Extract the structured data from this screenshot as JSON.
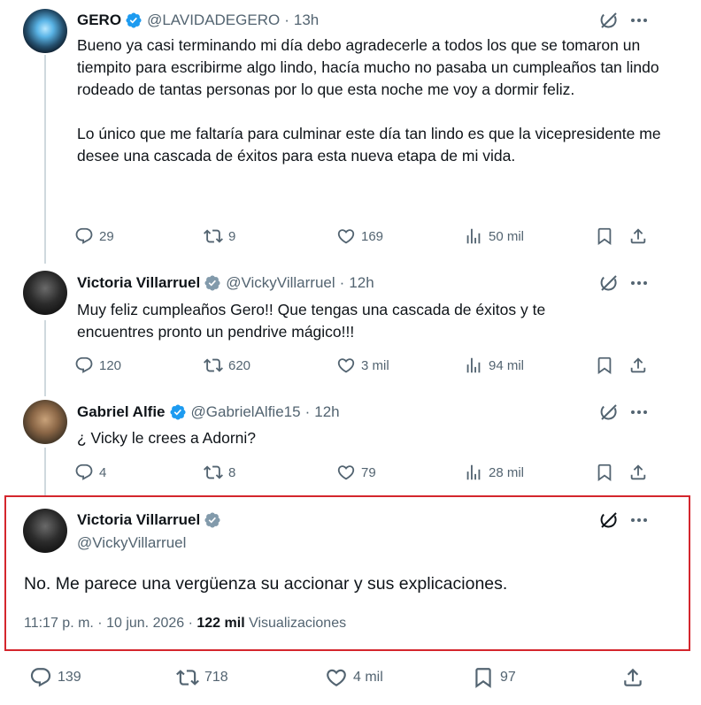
{
  "tweets": [
    {
      "name": "GERO",
      "handle": "@LAVIDADEGERO",
      "time": "13h",
      "text": "Bueno ya casi terminando mi día debo agradecerle a todos los que se tomaron un tiempito para escribirme algo lindo, hacía mucho no pasaba un cumpleaños tan lindo rodeado de tantas personas por lo que esta noche me voy a dormir feliz.\n\nLo único que me faltaría para culminar este día tan lindo es que la vicepresidente me desee una cascada de éxitos para esta nueva etapa de mi vida.",
      "replies": "29",
      "reposts": "9",
      "likes": "169",
      "views": "50 mil",
      "verified_color": "#1d9bf0"
    },
    {
      "name": "Victoria Villarruel",
      "handle": "@VickyVillarruel",
      "time": "12h",
      "text": "Muy feliz cumpleaños Gero!! Que tengas una cascada de éxitos y te encuentres pronto un pendrive mágico!!!",
      "replies": "120",
      "reposts": "620",
      "likes": "3 mil",
      "views": "94 mil",
      "verified_color": "#829aab"
    },
    {
      "name": "Gabriel Alfie",
      "handle": "@GabrielAlfie15",
      "time": "12h",
      "text": "¿ Vicky le crees a Adorni?",
      "replies": "4",
      "reposts": "8",
      "likes": "79",
      "views": "28 mil",
      "verified_color": "#1d9bf0"
    }
  ],
  "focused": {
    "name": "Victoria Villarruel",
    "handle": "@VickyVillarruel",
    "text": "No. Me parece una vergüenza su accionar y sus explicaciones.",
    "timestamp": "11:17 p. m. · 10 jun. 2026 · ",
    "views_count": "122 mil",
    "views_label": "Visualizaciones",
    "replies": "139",
    "reposts": "718",
    "likes": "4 mil",
    "bookmarks": "97"
  },
  "colors": {
    "highlight_border": "#d4262d",
    "secondary_text": "#536471",
    "thread_line": "#cfd9de"
  },
  "icons": [
    "reply-icon",
    "repost-icon",
    "like-icon",
    "views-icon",
    "bookmark-icon",
    "share-icon",
    "grok-icon",
    "more-icon",
    "verified-icon"
  ]
}
